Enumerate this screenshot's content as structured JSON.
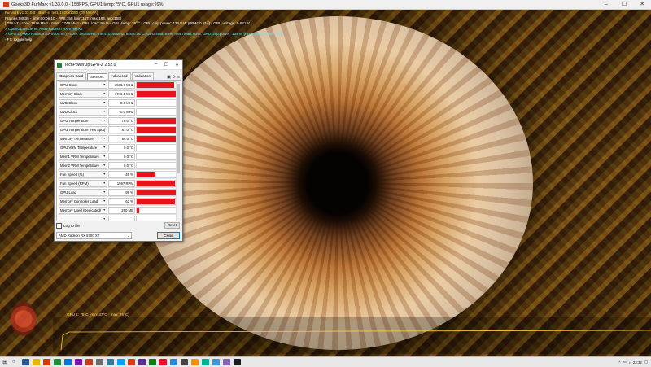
{
  "furmark": {
    "window_title": "Geeks3D FurMark v1.33.0.0 - 158FPS, GPU1 temp:75°C, GPU1 usage:99%",
    "hud_lines": [
      {
        "text": "FurMark v1.33.0.0 - Burn-in test, 1920x1080 (0X MSAA)",
        "color": "y"
      },
      {
        "text": "Frames:58535 - time:00:06:10 - FPS:158 (min:147, max:164, avg:159)",
        "color": "w"
      },
      {
        "text": "[ GPU-Z ] core: 1576 MHz - mem: 1746 MHz - GPU load: 99 % - GPU temp: 76°C - GPU chip power: 134.8 W (PPW: 0.814) - GPU voltage: 0.881 V",
        "color": "w"
      },
      {
        "text": "> OpenGL renderer: AMD Radeon RX 5700 XT",
        "color": "c"
      },
      {
        "text": "> GPU 1 (AMD Radeon RX 5700 XT) - core: 1576MHz, mem: 1746MHz, temp: 76°C, GPU load: 99%, mem load: 63%, GPU chip power: 134 W (PPW: 0.814), fan: 46%",
        "color": "c"
      },
      {
        "text": "- F1: toggle help",
        "color": "w"
      }
    ],
    "temp_graph_label": "GPU 1: 75°C (min: 37°C - max: 76°C)"
  },
  "gpuz": {
    "title": "TechPowerUp GPU-Z 2.52.0",
    "tabs": [
      "Graphics Card",
      "Sensors",
      "Advanced",
      "Validation"
    ],
    "active_tab": "Sensors",
    "sensors": [
      {
        "label": "GPU Clock",
        "value": "1576.0 MHz",
        "fill": 0.92
      },
      {
        "label": "Memory Clock",
        "value": "1746.0 MHz",
        "fill": 0.95
      },
      {
        "label": "UVD Clock",
        "value": "0.0 MHz",
        "fill": 0
      },
      {
        "label": "UVD Clock",
        "value": "0.0 MHz",
        "fill": 0
      },
      {
        "label": "GPU Temperature",
        "value": "76.0 °C",
        "fill": 0.95
      },
      {
        "label": "GPU Temperature (Hot Spot)",
        "value": "87.0 °C",
        "fill": 0.95
      },
      {
        "label": "Memory Temperature",
        "value": "86.0 °C",
        "fill": 0.95
      },
      {
        "label": "GPU VRM Temperature",
        "value": "0.0 °C",
        "fill": 0
      },
      {
        "label": "Mem1 VRM Temperature",
        "value": "0.0 °C",
        "fill": 0
      },
      {
        "label": "Mem2 VRM Temperature",
        "value": "0.0 °C",
        "fill": 0
      },
      {
        "label": "Fan Speed (%)",
        "value": "46 %",
        "fill": 0.45
      },
      {
        "label": "Fan Speed (RPM)",
        "value": "1597 RPM",
        "fill": 0.93
      },
      {
        "label": "GPU Load",
        "value": "99 %",
        "fill": 0.95
      },
      {
        "label": "Memory Controller Load",
        "value": "62 %",
        "fill": 0.93
      },
      {
        "label": "Memory Used (Dedicated)",
        "value": "280 MB",
        "fill": 0.05
      },
      {
        "label": "",
        "value": "",
        "fill": 0
      }
    ],
    "log_label": "Log to file",
    "reset_label": "Reset",
    "gpu_select": "AMD Radeon RX 5700 XT",
    "close_label": "Close",
    "graph_color": "#e8141d"
  },
  "taskbar": {
    "time": "23:32",
    "date": "",
    "icons": [
      "#2b579a",
      "#e8b800",
      "#d83b01",
      "#1e8e3e",
      "#0078d7",
      "#7719aa",
      "#c43e1c",
      "#6c6c6c",
      "#2d7d9a",
      "#00a4ef",
      "#d83a1a",
      "#5c2d91",
      "#107c10",
      "#e81123",
      "#2b88d8",
      "#444444",
      "#ff8c00",
      "#00b294",
      "#3a96dd",
      "#8764b8",
      "#1b1b1b"
    ]
  }
}
